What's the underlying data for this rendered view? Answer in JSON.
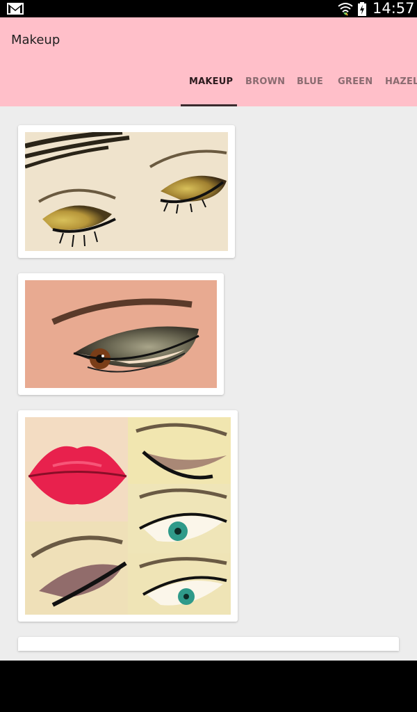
{
  "status_bar": {
    "time": "14:57",
    "icons": [
      "gmail-notification-icon",
      "wifi-icon",
      "battery-charging-icon"
    ]
  },
  "app_bar": {
    "title": "Makeup"
  },
  "tabs": [
    {
      "label": "MAKEUP",
      "selected": true
    },
    {
      "label": "BROWN",
      "selected": false
    },
    {
      "label": "BLUE",
      "selected": false
    },
    {
      "label": "GREEN",
      "selected": false
    },
    {
      "label": "HAZEL",
      "selected": false
    }
  ],
  "gallery": {
    "items": [
      {
        "subject": "gold glitter eyeshadow on closed eyes"
      },
      {
        "subject": "smoky eye with brown iris"
      },
      {
        "subject": "red lips and winged eyeliner collage"
      }
    ]
  },
  "colors": {
    "app_bar": "#ffbfc9",
    "background": "#ededed",
    "tab_selected": "#2b1a1d",
    "tab_unselected": "#8a6b70"
  }
}
